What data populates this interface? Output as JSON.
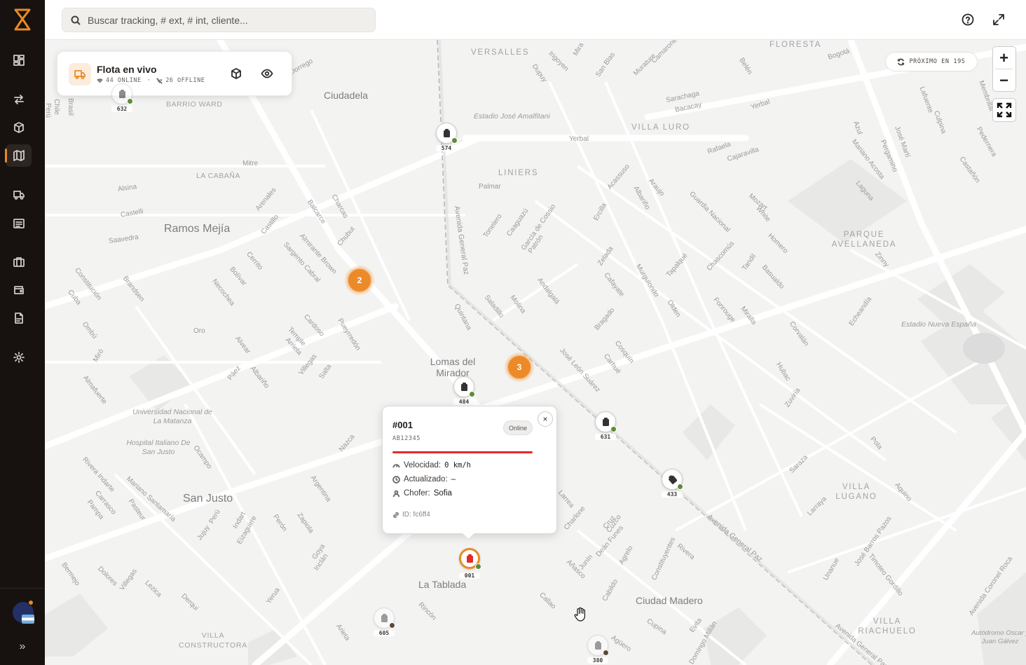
{
  "sidebar": {
    "logo": "brand-logo",
    "items": [
      {
        "name": "dashboard",
        "icon": "grid-icon"
      },
      {
        "name": "transfers",
        "icon": "arrows-icon"
      },
      {
        "name": "packages",
        "icon": "box-icon"
      },
      {
        "name": "map",
        "icon": "map-icon",
        "active": true
      },
      {
        "name": "fleet",
        "icon": "truck-icon"
      },
      {
        "name": "documents",
        "icon": "list-icon"
      },
      {
        "name": "business",
        "icon": "briefcase-icon"
      },
      {
        "name": "wallet",
        "icon": "wallet-icon"
      },
      {
        "name": "reports",
        "icon": "file-icon"
      },
      {
        "name": "settings",
        "icon": "gear-icon"
      }
    ],
    "collapse_label": "»",
    "accent_color": "#e98a26"
  },
  "search": {
    "placeholder": "Buscar tracking, # ext, # int, cliente..."
  },
  "fleet_panel": {
    "title": "Flota en vivo",
    "online": "44 ONLINE",
    "separator": "·",
    "offline": "26 OFFLINE"
  },
  "refresh": {
    "label": "PRÓXIMO EN 19S"
  },
  "zoom": {
    "in_label": "+",
    "out_label": "−"
  },
  "map": {
    "neighborhoods": [
      "VERSALLES",
      "FLORESTA",
      "BARRIO WARD",
      "LA CABAÑA",
      "LINIERS",
      "VILLA LURO",
      "PARQUE AVELLANEDA",
      "VILLA LUGANO",
      "VILLA RIACHUELO",
      "VILLA CONSTRUCTORA"
    ],
    "cities": [
      "Ciudadela",
      "Ramos Mejía",
      "Lomas del Mirador",
      "San Justo",
      "La Tablada",
      "Ciudad Madero"
    ],
    "pois": [
      "Estadio José Amalfitani",
      "Estadio Nueva España",
      "Universidad Nacional de La Matanza",
      "Hospital Italiano De San Justo",
      "Autódromo Oscar y Juan Gálvez"
    ],
    "streets": [
      "Avenida General Paz",
      "Yerbal",
      "Bogotá",
      "Irigoyen",
      "Dupuy",
      "San Blas",
      "Murature",
      "Belén",
      "Sarachaga",
      "Bacacay",
      "Rafaela",
      "Cajaravilla",
      "Palmar",
      "Mitre",
      "Alsina",
      "Castelli",
      "Saavedra",
      "Arenales",
      "Balcarce",
      "Charcas",
      "Chubut",
      "Almirante Brown",
      "Sargento Cabral",
      "Castillo",
      "Cerrito",
      "Bolívar",
      "Necochea",
      "Brandsen",
      "Constitución",
      "Cuba",
      "Ombú",
      "Miró",
      "Almafuerte",
      "Oro",
      "Alvear",
      "Páez",
      "Albariño",
      "Villegas",
      "Salta",
      "Cardoso",
      "Temple",
      "Arrieta",
      "Pueyrredón",
      "Quintana",
      "Saladillo",
      "Molina",
      "Andalgalá",
      "José León Suárez",
      "Carhué",
      "Cosquín",
      "Bragado",
      "Cafayate",
      "Zelada",
      "Murguiondo",
      "Tapalqué",
      "Chascomús",
      "Fonrouge",
      "Olden",
      "Miralla",
      "Tandil",
      "Basualdo",
      "Homero",
      "White",
      "Mozart",
      "Guardia Nacional",
      "Albariño",
      "Araujo",
      "Acassuso",
      "Ercilla",
      "Tonelero",
      "Caaguazú",
      "García de Cossio",
      "Patrón",
      "Corvalán",
      "Hubac",
      "Zuviría",
      "Echeandía",
      "Pola",
      "Saraza",
      "Aquino",
      "Larraya",
      "Unanue",
      "José Barros Pazos",
      "Timoteo Gordillo",
      "Avenida Coronel Roca",
      "Cruz",
      "Nazca",
      "Argentina",
      "Ocampo",
      "Rivera Indarte",
      "Mariano Santamaría",
      "Carrasco",
      "Pampa",
      "Pasteur",
      "Perú",
      "Jujuy",
      "Indart",
      "Eizaguirre",
      "Perón",
      "Zapiola",
      "Goya",
      "Inclán",
      "Bermejo",
      "Dolores",
      "Villegas",
      "Lezica",
      "Derqui",
      "Yerua",
      "Rincón",
      "Arieta",
      "Callao",
      "Cabildo",
      "Agrelo",
      "Constituyentes",
      "Rivera",
      "Cupina",
      "Evita",
      "Domingo Millán",
      "Agüero",
      "Larrea",
      "Charlone",
      "Cuzco",
      "Deán Funes",
      "Junín",
      "Añasco",
      "Lafuente",
      "Culpina",
      "Pedernera",
      "Castañón",
      "Mariano Acosta",
      "Azul",
      "José Martí",
      "Pergamino",
      "Laguna",
      "Zinny",
      "Membrillar",
      "Mira",
      "Camarones",
      "Dorrego",
      "Brasil",
      "Chile",
      "Perú"
    ]
  },
  "clusters": [
    {
      "count": "2"
    },
    {
      "count": "3"
    }
  ],
  "vehicles": [
    {
      "id": "632",
      "status": "online",
      "icon": "truck-icon"
    },
    {
      "id": "574",
      "status": "online",
      "icon": "truck-icon"
    },
    {
      "id": "484",
      "status": "online",
      "icon": "truck-icon"
    },
    {
      "id": "631",
      "status": "online",
      "icon": "truck-icon"
    },
    {
      "id": "433",
      "status": "online",
      "icon": "truck-icon"
    },
    {
      "id": "001",
      "status": "online",
      "icon": "truck-icon",
      "selected": true
    },
    {
      "id": "605",
      "status": "offline",
      "icon": "truck-icon"
    },
    {
      "id": "380",
      "status": "offline",
      "icon": "truck-icon"
    }
  ],
  "popup": {
    "title": "#001",
    "plate": "AB12345",
    "status": "Online",
    "speed_label": "Velocidad:",
    "speed_value": "0 km/h",
    "updated_label": "Actualizado:",
    "updated_value": "–",
    "driver_label": "Chofer:",
    "driver_value": "Sofia",
    "id_label": "ID: fc6ff4",
    "close_label": "×",
    "bar_color": "#e02b2b"
  },
  "colors": {
    "accent": "#e98a26",
    "online_dot": "#5f8a3a",
    "offline_dot": "#5a4a3c",
    "sidebar_bg": "#17120f"
  }
}
